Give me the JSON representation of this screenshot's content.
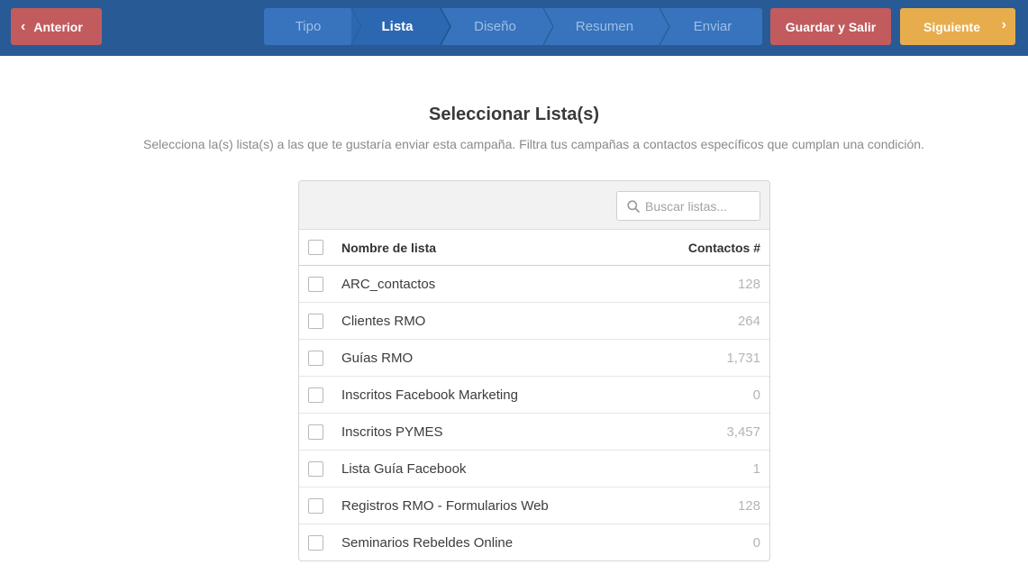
{
  "nav": {
    "prev_label": "Anterior",
    "save_label": "Guardar y Salir",
    "next_label": "Siguiente"
  },
  "steps": [
    {
      "label": "Tipo",
      "active": false
    },
    {
      "label": "Lista",
      "active": true
    },
    {
      "label": "Diseño",
      "active": false
    },
    {
      "label": "Resumen",
      "active": false
    },
    {
      "label": "Enviar",
      "active": false
    }
  ],
  "page": {
    "title": "Seleccionar Lista(s)",
    "subtitle": "Selecciona la(s) lista(s) a las que te gustaría enviar esta campaña. Filtra tus campañas a contactos específicos que cumplan una condición."
  },
  "search": {
    "placeholder": "Buscar listas...",
    "icon": "search-icon"
  },
  "table": {
    "columns": {
      "name": "Nombre de lista",
      "count": "Contactos #"
    },
    "rows": [
      {
        "name": "ARC_contactos",
        "count": "128"
      },
      {
        "name": "Clientes RMO",
        "count": "264"
      },
      {
        "name": "Guías RMO",
        "count": "1,731"
      },
      {
        "name": "Inscritos Facebook Marketing",
        "count": "0"
      },
      {
        "name": "Inscritos PYMES",
        "count": "3,457"
      },
      {
        "name": "Lista Guía Facebook",
        "count": "1"
      },
      {
        "name": "Registros RMO - Formularios Web",
        "count": "128"
      },
      {
        "name": "Seminarios Rebeldes Online",
        "count": "0"
      }
    ]
  },
  "colors": {
    "topbar": "#285a96",
    "steps_bg": "#3874bd",
    "step_active": "#2c68b2",
    "danger": "#c25b5e",
    "warning": "#e7ad4d"
  }
}
